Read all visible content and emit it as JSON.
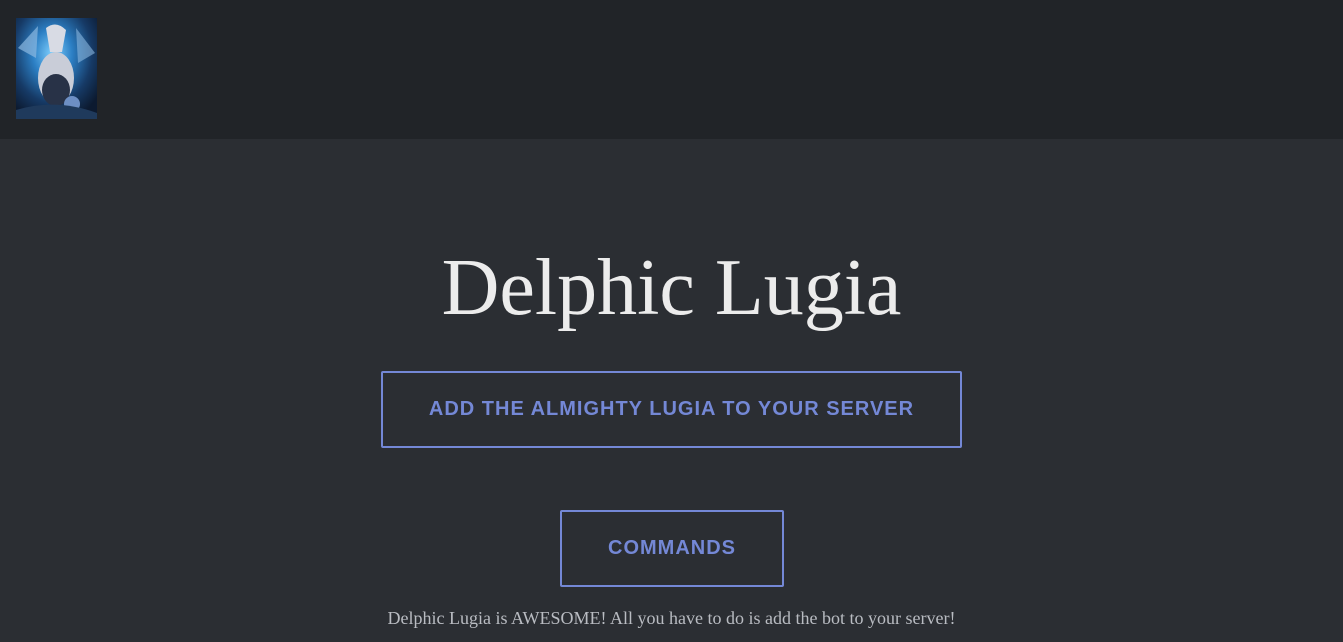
{
  "header": {
    "avatar_icon": "lugia-avatar-icon"
  },
  "hero": {
    "title": "Delphic Lugia",
    "add_button_label": "ADD THE ALMIGHTY LUGIA TO YOUR SERVER",
    "commands_button_label": "COMMANDS",
    "tagline": "Delphic Lugia is AWESOME! All you have to do is add the bot to your server!"
  },
  "colors": {
    "header_bg": "#212428",
    "page_bg": "#2b2e33",
    "accent": "#7488d6",
    "title_text": "#ececec",
    "tagline_text": "#b9bcc2"
  }
}
